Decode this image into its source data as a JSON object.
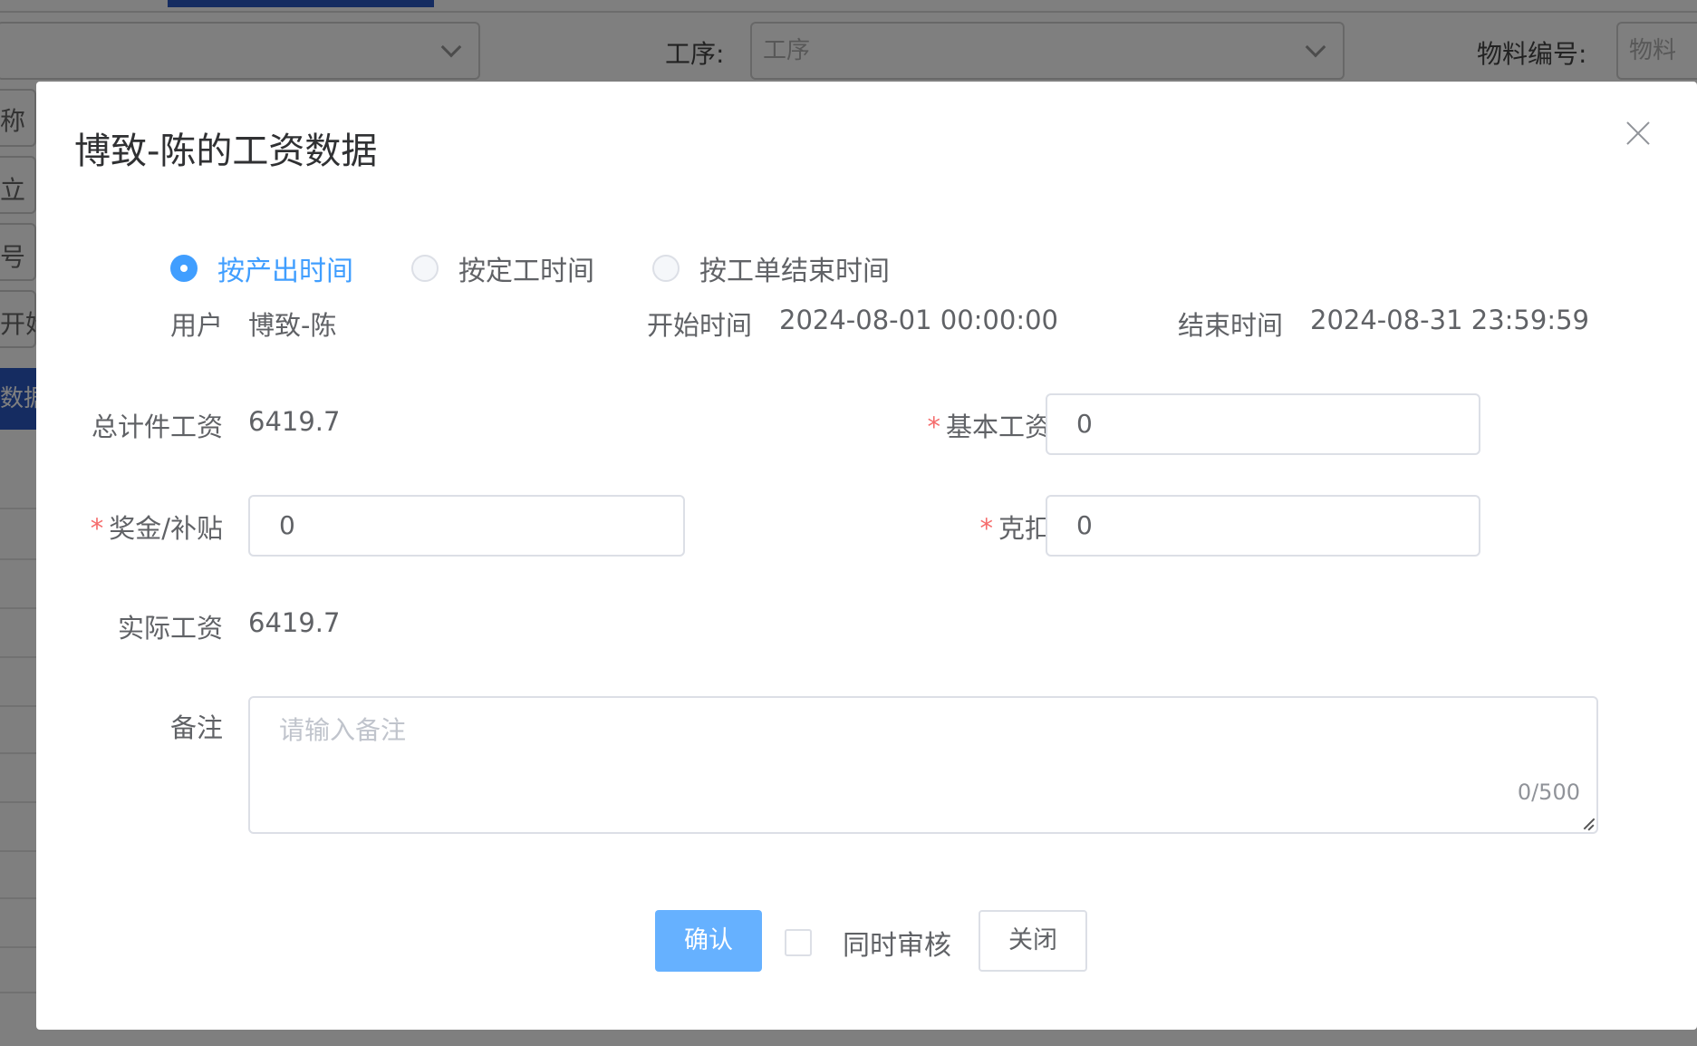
{
  "background": {
    "filter_process_label": "工序:",
    "filter_process_placeholder": "工序",
    "filter_material_label": "物料编号:",
    "filter_material_placeholder": "物料",
    "side_fragments": [
      "称",
      "立",
      "号",
      "开始"
    ],
    "side_active": "数据"
  },
  "dialog": {
    "title": "博致-陈的工资数据",
    "radios": [
      {
        "label": "按产出时间",
        "checked": true
      },
      {
        "label": "按定工时间",
        "checked": false
      },
      {
        "label": "按工单结束时间",
        "checked": false
      }
    ],
    "user_label": "用户",
    "user_value": "博致-陈",
    "start_label": "开始时间",
    "start_value": "2024-08-01 00:00:00",
    "end_label": "结束时间",
    "end_value": "2024-08-31 23:59:59",
    "total_piece_label": "总计件工资",
    "total_piece_value": "6419.7",
    "base_salary_label": "基本工资",
    "base_salary_value": "0",
    "bonus_label": "奖金/补贴",
    "bonus_value": "0",
    "deduction_label": "克扣",
    "deduction_value": "0",
    "actual_label": "实际工资",
    "actual_value": "6419.7",
    "remark_label": "备注",
    "remark_placeholder": "请输入备注",
    "remark_count": "0/500",
    "confirm_label": "确认",
    "audit_label": "同时审核",
    "close_label": "关闭"
  },
  "colors": {
    "primary": "#409eff",
    "primary_light": "#66b1ff",
    "required": "#f56c6c"
  }
}
